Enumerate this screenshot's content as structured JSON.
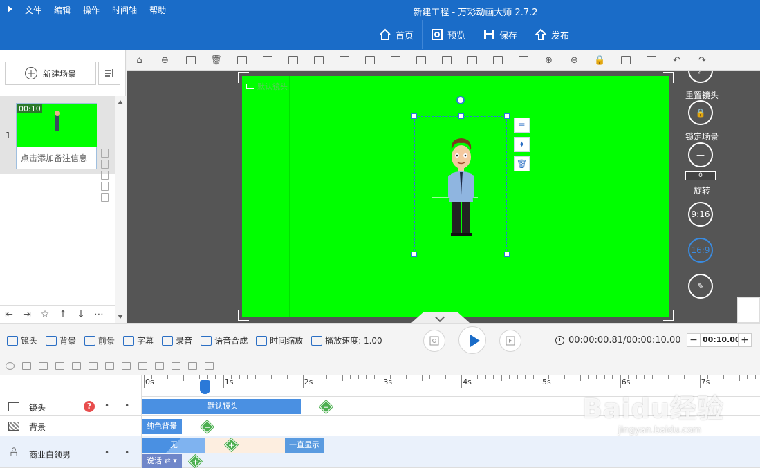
{
  "app": {
    "title": "新建工程 - 万彩动画大师 2.7.2",
    "menu": [
      "文件",
      "编辑",
      "操作",
      "时间轴",
      "帮助"
    ],
    "top_buttons": [
      "首页",
      "预览",
      "保存",
      "发布"
    ]
  },
  "scenes": {
    "new_scene_label": "新建场景",
    "items": [
      {
        "index": "1",
        "duration": "00:10",
        "note_placeholder": "点击添加备注信息"
      }
    ]
  },
  "stage": {
    "camera_tag": "默认镜头",
    "background_color": "#00ff00",
    "right_controls": {
      "reset_camera": "重置镜头",
      "lock_scene": "锁定场景",
      "rotate": "旋转",
      "rotate_value": "0",
      "ratio_916": "9:16",
      "ratio_169": "16:9"
    }
  },
  "timeline_bar": {
    "items": [
      "镜头",
      "背景",
      "前景",
      "字幕",
      "录音",
      "语音合成",
      "时间缩放"
    ],
    "speed_label": "播放速度: 1.00",
    "time_readout": "00:00:00.81/00:00:10.00",
    "duration_value": "00:10.00",
    "minus": "−",
    "plus": "+"
  },
  "ruler": {
    "labels": [
      "0s",
      "1s",
      "2s",
      "3s",
      "4s",
      "5s",
      "6s",
      "7s"
    ]
  },
  "tracks": {
    "camera": {
      "name": "镜头",
      "help": "?",
      "clip_label": "默认镜头"
    },
    "background": {
      "name": "背景",
      "clip_label": "纯色背景"
    },
    "character": {
      "name": "商业白领男",
      "enter_label": "无",
      "stay_label": "一直显示",
      "action_label": "说话"
    }
  },
  "colors": {
    "brand_blue": "#1a6cc8",
    "stage_bg": "#555555",
    "clip_blue": "#4a90e2",
    "keyframe_green": "#4caf50",
    "playhead_red": "#e53935"
  },
  "watermark": {
    "main": "Baidu经验",
    "sub": "jingyan.baidu.com"
  }
}
